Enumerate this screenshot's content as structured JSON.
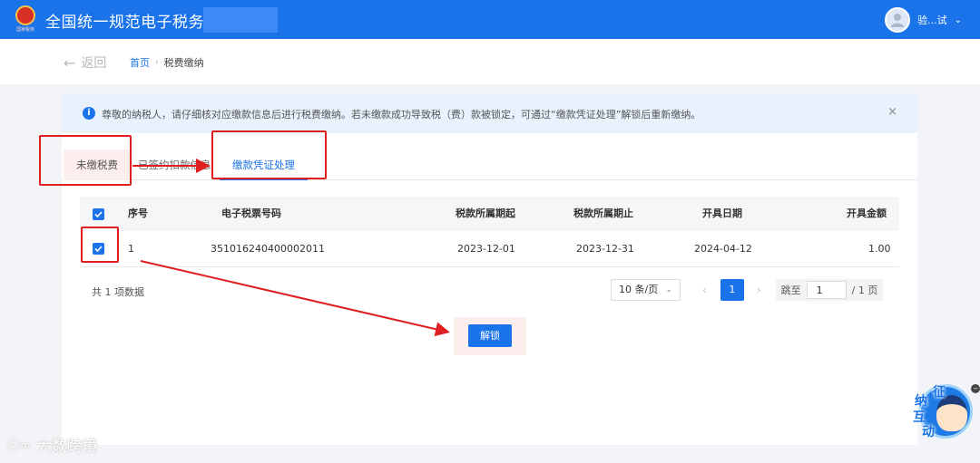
{
  "header": {
    "title": "全国统一规范电子税务局",
    "emblem_text": "国家税务",
    "user_name": "验...试"
  },
  "nav": {
    "back_label": "返回",
    "breadcrumb_home": "首页",
    "breadcrumb_current": "税费缴纳"
  },
  "notice": {
    "text": "尊敬的纳税人，请仔细核对应缴款信息后进行税费缴纳。若未缴款成功导致税（费）款被锁定，可通过“缴款凭证处理”解锁后重新缴纳。",
    "close": "×"
  },
  "tabs": [
    {
      "label": "未缴税费",
      "active": false
    },
    {
      "label": "已签约扣款信息",
      "active": false
    },
    {
      "label": "缴款凭证处理",
      "active": true
    }
  ],
  "table": {
    "columns": [
      "序号",
      "电子税票号码",
      "税款所属期起",
      "税款所属期止",
      "开具日期",
      "开具金额"
    ],
    "rows": [
      {
        "index": "1",
        "ticket_no": "351016240400002011",
        "period_start": "2023-12-01",
        "period_end": "2023-12-31",
        "issue_date": "2024-04-12",
        "amount": "1.00",
        "checked": true
      }
    ],
    "header_checked": true
  },
  "pagination": {
    "total_text": "共 1 项数据",
    "page_size": "10 条/页",
    "current_page": "1",
    "jump_label": "跳至",
    "jump_value": "1",
    "total_pages": "/ 1 页"
  },
  "actions": {
    "unlock_label": "解锁"
  },
  "watermark": {
    "logo": "ⓒ∞",
    "text": "大数跨境"
  },
  "mascot": {
    "chars": [
      "征",
      "纳",
      "互",
      "动"
    ]
  },
  "colors": {
    "primary": "#1a73e8",
    "annotation_red": "#e02020"
  }
}
